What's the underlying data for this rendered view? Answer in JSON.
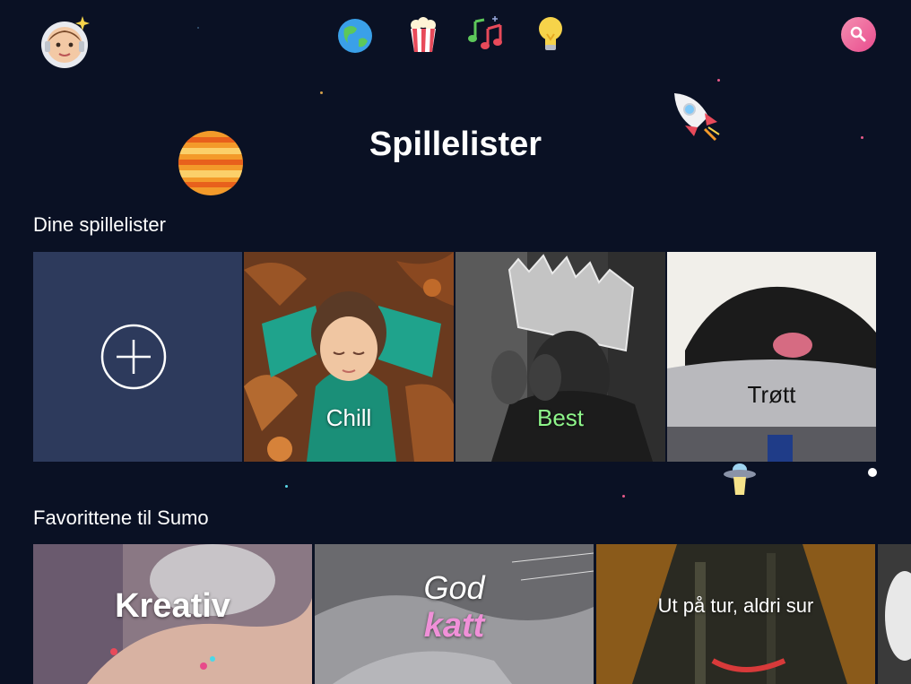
{
  "header": {
    "page_title": "Spillelister",
    "nav": [
      {
        "name": "globe-icon"
      },
      {
        "name": "popcorn-icon"
      },
      {
        "name": "music-notes-icon"
      },
      {
        "name": "lightbulb-icon"
      }
    ],
    "search_icon": "magnifier-icon"
  },
  "my_playlists": {
    "title": "Dine spillelister",
    "tiles": [
      {
        "label": "Chill",
        "color": "#ffffff"
      },
      {
        "label": "Best",
        "color": "#8ef58a"
      },
      {
        "label": "Trøtt",
        "color": "#111111"
      }
    ]
  },
  "favorites": {
    "title": "Favorittene til Sumo",
    "tiles": [
      {
        "label": "Kreativ"
      },
      {
        "label_top": "God",
        "label_bottom": "katt"
      },
      {
        "label": "Ut på tur, aldri sur"
      }
    ]
  },
  "colors": {
    "background": "#0a1124",
    "add_tile": "#2d3a5c",
    "search_button": "#e94c8e",
    "best_label": "#8ef58a",
    "katt_label": "#f090d8"
  }
}
